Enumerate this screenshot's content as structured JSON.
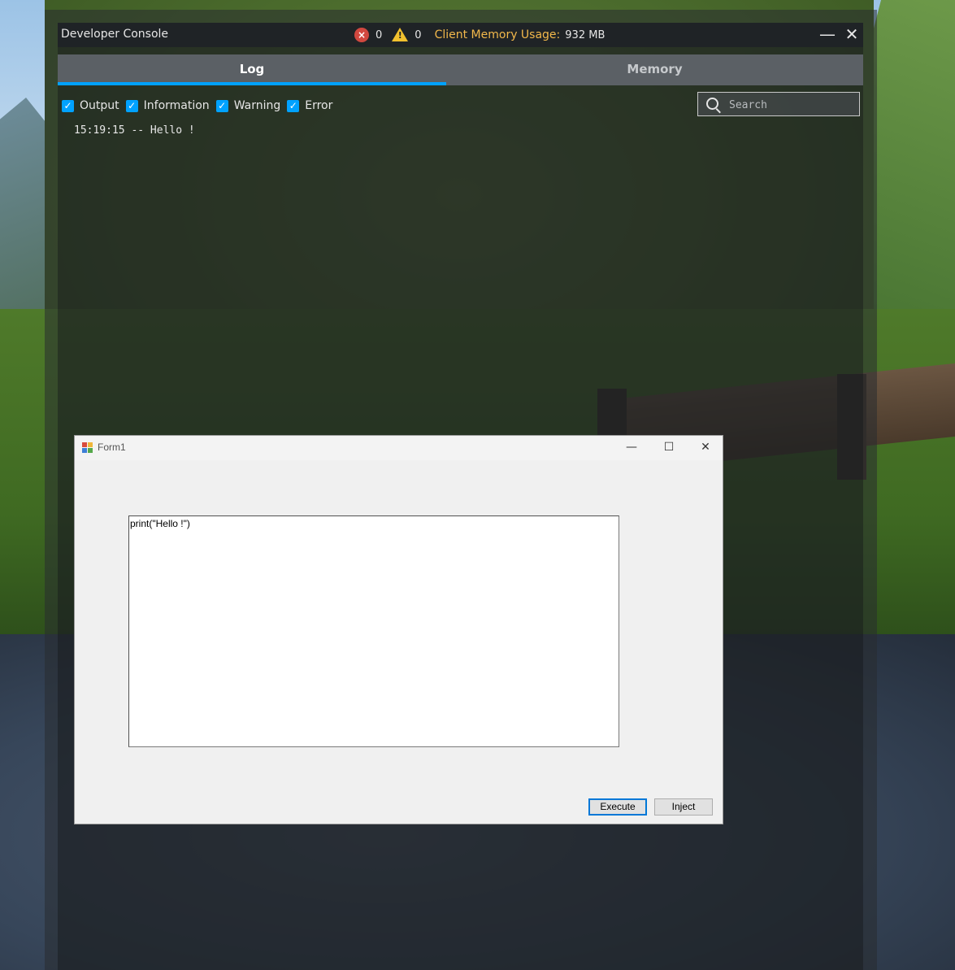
{
  "console": {
    "title": "Developer Console",
    "error_count": "0",
    "warning_count": "0",
    "memory_label": "Client Memory Usage:",
    "memory_value": "932 MB",
    "tabs": [
      {
        "label": "Log",
        "active": true
      },
      {
        "label": "Memory",
        "active": false
      }
    ],
    "filters": [
      {
        "label": "Output",
        "checked": true
      },
      {
        "label": "Information",
        "checked": true
      },
      {
        "label": "Warning",
        "checked": true
      },
      {
        "label": "Error",
        "checked": true
      }
    ],
    "search_placeholder": "Search",
    "log_lines": [
      "15:19:15 -- Hello !"
    ],
    "accent_color": "#00a2ff",
    "error_color": "#d1483f",
    "warning_color": "#f2c12e",
    "memory_label_color": "#f2b84b"
  },
  "form1": {
    "title": "Form1",
    "code": "print(\"Hello !\")",
    "buttons": {
      "execute": "Execute",
      "inject": "Inject"
    }
  }
}
